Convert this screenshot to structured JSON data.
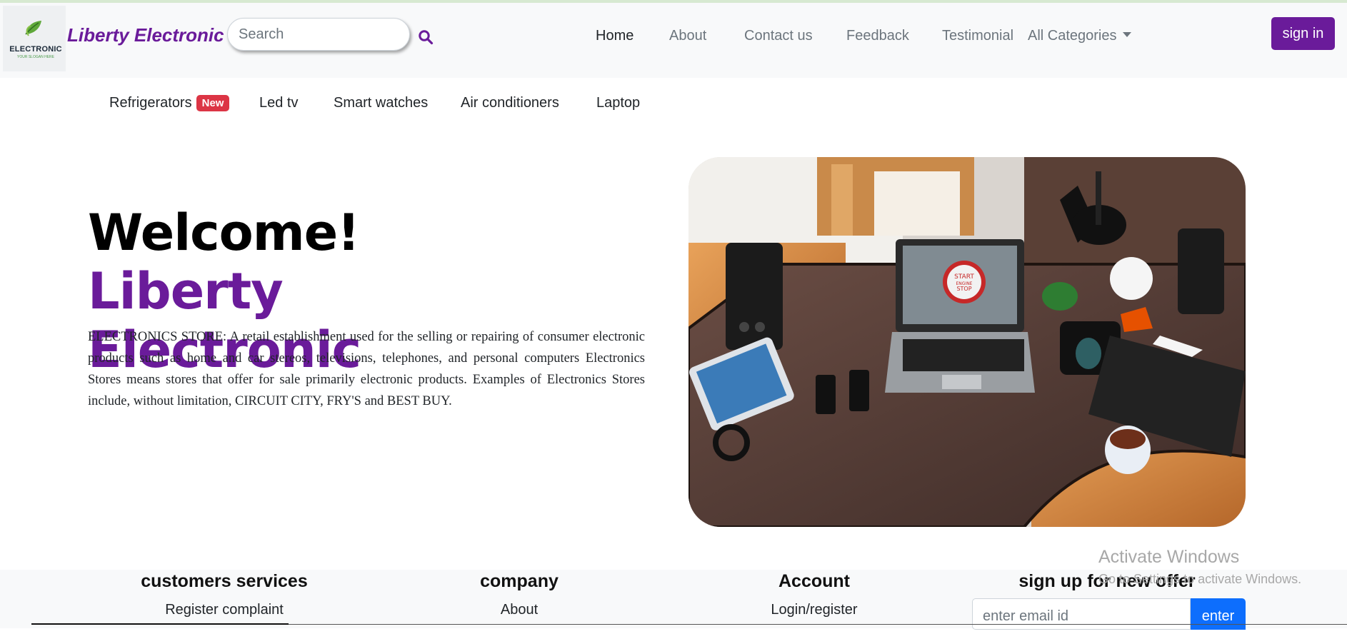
{
  "brand": {
    "logo_text": "ELECTRONIC",
    "logo_subtext": "YOUR SLOGAN HERE",
    "name": "Liberty Electronic"
  },
  "search": {
    "placeholder": "Search",
    "icon": "search-icon"
  },
  "nav": {
    "links": [
      "Home",
      "About",
      "Contact us",
      "Feedback",
      "Testimonial"
    ],
    "active": "Home",
    "dropdown_label": "All Categories",
    "signin_label": "sign in"
  },
  "categories": {
    "items": [
      "Refrigerators",
      "Led tv",
      "Smart watches",
      "Air conditioners",
      "Laptop"
    ],
    "badge": "New"
  },
  "hero": {
    "title_plain": "Welcome!",
    "title_accent": "Liberty Electronic",
    "description": "ELECTRONICS STORE: A retail establishment used for the selling or repairing of consumer electronic products such as home and car stereos, televisions, telephones, and personal computers Electronics Stores means stores that offer for sale primarily electronic products. Examples of Electronics Stores include, without limitation, CIRCUIT CITY, FRY'S and BEST BUY.",
    "image": {
      "laptop_screen_text": [
        "START",
        "ENGINE",
        "STOP"
      ]
    }
  },
  "footer": {
    "columns": [
      {
        "title": "customers services",
        "link": "Register complaint"
      },
      {
        "title": "company",
        "link": "About"
      },
      {
        "title": "Account",
        "link": "Login/register"
      }
    ],
    "signup": {
      "title": "sign up for new offer",
      "placeholder": "enter email id",
      "button": "enter"
    }
  },
  "watermark": {
    "title": "Activate Windows",
    "subtitle": "Go to Settings to activate Windows."
  },
  "colors": {
    "accent": "#6a1b9a",
    "badge": "#dc3545",
    "button_blue": "#0d6efd",
    "navbar_bg": "#f8f9fa"
  }
}
